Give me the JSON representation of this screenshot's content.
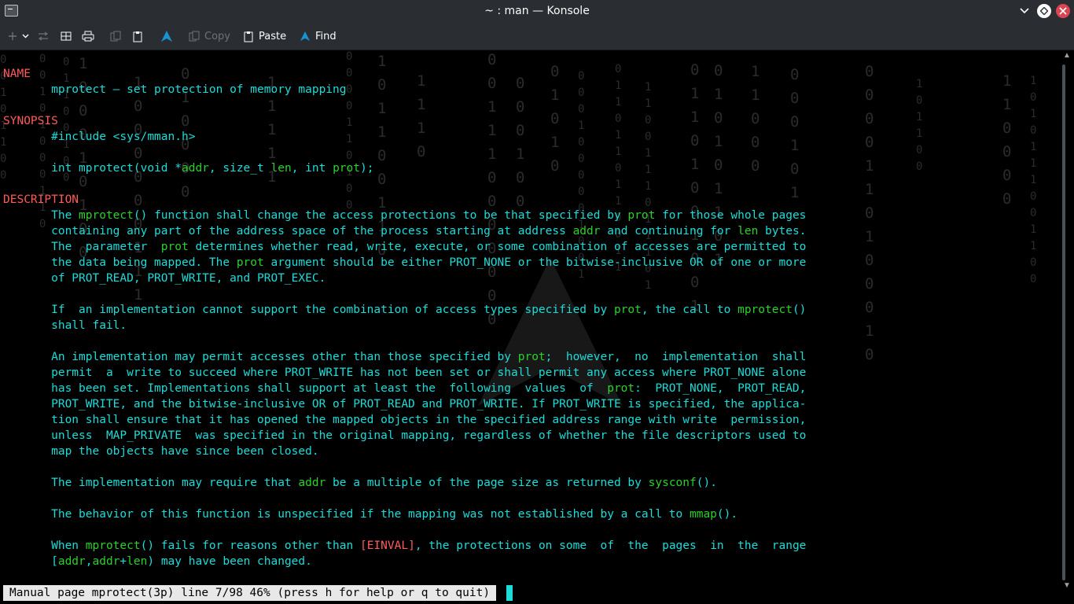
{
  "window": {
    "title": "~ : man — Konsole"
  },
  "toolbar": {
    "copy_label": "Copy",
    "paste_label": "Paste",
    "find_label": "Find"
  },
  "manpage": {
    "lines": [
      [
        {
          "t": "NAME",
          "c": "hdr"
        }
      ],
      [
        {
          "t": "       mprotect — set protection of memory mapping"
        }
      ],
      [
        {
          "t": ""
        }
      ],
      [
        {
          "t": "SYNOPSIS",
          "c": "hdr"
        }
      ],
      [
        {
          "t": "       #include <sys/mman.h>"
        }
      ],
      [
        {
          "t": ""
        }
      ],
      [
        {
          "t": "       int mprotect(void *"
        },
        {
          "t": "addr",
          "c": "hl"
        },
        {
          "t": ", size_t "
        },
        {
          "t": "len",
          "c": "hl"
        },
        {
          "t": ", int "
        },
        {
          "t": "prot",
          "c": "hl"
        },
        {
          "t": ");"
        }
      ],
      [
        {
          "t": ""
        }
      ],
      [
        {
          "t": "DESCRIPTION",
          "c": "hdr"
        }
      ],
      [
        {
          "t": "       The "
        },
        {
          "t": "mprotect",
          "c": "hl"
        },
        {
          "t": "() function shall change the access protections to be that specified by "
        },
        {
          "t": "prot",
          "c": "hl"
        },
        {
          "t": " for those whole pages"
        }
      ],
      [
        {
          "t": "       containing any part of the address space of the process starting at address "
        },
        {
          "t": "addr",
          "c": "hl"
        },
        {
          "t": " and continuing for "
        },
        {
          "t": "len",
          "c": "hl"
        },
        {
          "t": " bytes."
        }
      ],
      [
        {
          "t": "       The  parameter  "
        },
        {
          "t": "prot",
          "c": "hl"
        },
        {
          "t": " determines whether read, write, execute, or some combination of accesses are permitted to"
        }
      ],
      [
        {
          "t": "       the data being mapped. The "
        },
        {
          "t": "prot",
          "c": "hl"
        },
        {
          "t": " argument should be either PROT_NONE or the bitwise-inclusive OR of one or more"
        }
      ],
      [
        {
          "t": "       of PROT_READ, PROT_WRITE, and PROT_EXEC."
        }
      ],
      [
        {
          "t": ""
        }
      ],
      [
        {
          "t": "       If  an implementation cannot support the combination of access types specified by "
        },
        {
          "t": "prot",
          "c": "hl"
        },
        {
          "t": ", the call to "
        },
        {
          "t": "mprotect",
          "c": "hl"
        },
        {
          "t": "()"
        }
      ],
      [
        {
          "t": "       shall fail."
        }
      ],
      [
        {
          "t": ""
        }
      ],
      [
        {
          "t": "       An implementation may permit accesses other than those specified by "
        },
        {
          "t": "prot",
          "c": "hl"
        },
        {
          "t": ";  however,  no  implementation  shall"
        }
      ],
      [
        {
          "t": "       permit  a  write to succeed where PROT_WRITE has not been set or shall permit any access where PROT_NONE alone"
        }
      ],
      [
        {
          "t": "       has been set. Implementations shall support at least the  following  values  of  "
        },
        {
          "t": "prot",
          "c": "hl"
        },
        {
          "t": ":  PROT_NONE,  PROT_READ,"
        }
      ],
      [
        {
          "t": "       PROT_WRITE, and the bitwise-inclusive OR of PROT_READ and PROT_WRITE. If PROT_WRITE is specified, the applica‐"
        }
      ],
      [
        {
          "t": "       tion shall ensure that it has opened the mapped objects in the specified address range with write  permission,"
        }
      ],
      [
        {
          "t": "       unless  MAP_PRIVATE  was specified in the original mapping, regardless of whether the file descriptors used to"
        }
      ],
      [
        {
          "t": "       map the objects have since been closed."
        }
      ],
      [
        {
          "t": ""
        }
      ],
      [
        {
          "t": "       The implementation may require that "
        },
        {
          "t": "addr",
          "c": "hl"
        },
        {
          "t": " be a multiple of the page size as returned by "
        },
        {
          "t": "sysconf",
          "c": "hl"
        },
        {
          "t": "()."
        }
      ],
      [
        {
          "t": ""
        }
      ],
      [
        {
          "t": "       The behavior of this function is unspecified if the mapping was not established by a call to "
        },
        {
          "t": "mmap",
          "c": "hl"
        },
        {
          "t": "()."
        }
      ],
      [
        {
          "t": ""
        }
      ],
      [
        {
          "t": "       When "
        },
        {
          "t": "mprotect",
          "c": "hl"
        },
        {
          "t": "() fails for reasons other than "
        },
        {
          "t": "[EINVAL]",
          "c": "err"
        },
        {
          "t": ", the protections on some  of  the  pages  in  the  range"
        }
      ],
      [
        {
          "t": "       ["
        },
        {
          "t": "addr",
          "c": "hl"
        },
        {
          "t": ","
        },
        {
          "t": "addr",
          "c": "hl"
        },
        {
          "t": "+"
        },
        {
          "t": "len",
          "c": "hl"
        },
        {
          "t": ") may have been changed."
        }
      ]
    ],
    "status_text": "Manual page mprotect(3p) line 7/98 46% (press h for help or q to quit)"
  },
  "colors": {
    "text": "#1cdcd8",
    "heading": "#ff5b5b",
    "highlight": "#2bd12b",
    "titlebar": "#2a2e32",
    "close": "#da4453"
  }
}
